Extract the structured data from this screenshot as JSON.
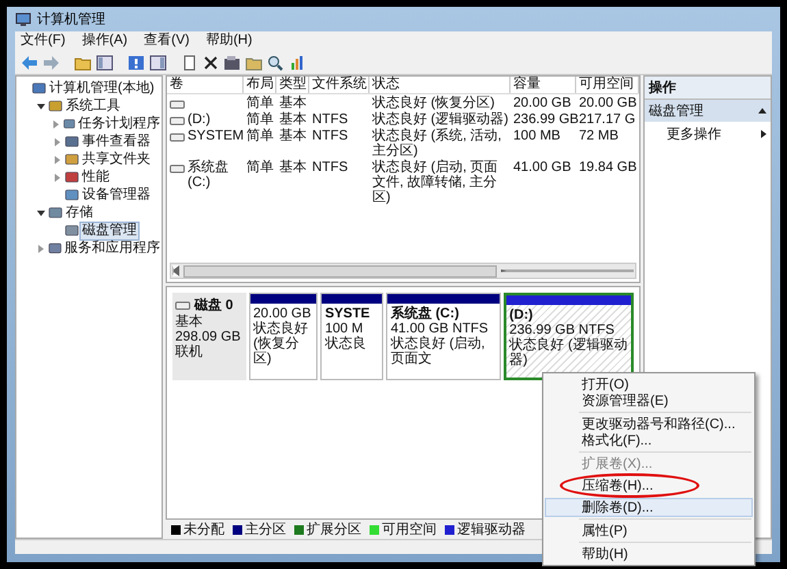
{
  "window": {
    "title": "计算机管理"
  },
  "menu": [
    "文件(F)",
    "操作(A)",
    "查看(V)",
    "帮助(H)"
  ],
  "tree": [
    {
      "label": "计算机管理(本地)",
      "kind": "computer",
      "selected": false,
      "children": [
        {
          "label": "系统工具",
          "kind": "tools",
          "expanded": true,
          "selected": false,
          "children": [
            {
              "label": "任务计划程序",
              "kind": "clock",
              "expanded": false,
              "selected": false
            },
            {
              "label": "事件查看器",
              "kind": "log",
              "expanded": false,
              "selected": false
            },
            {
              "label": "共享文件夹",
              "kind": "share",
              "expanded": false,
              "selected": false
            },
            {
              "label": "性能",
              "kind": "gauge",
              "expanded": false,
              "selected": false
            },
            {
              "label": "设备管理器",
              "kind": "device",
              "selected": false
            }
          ]
        },
        {
          "label": "存储",
          "kind": "storage",
          "expanded": true,
          "selected": false,
          "children": [
            {
              "label": "磁盘管理",
              "kind": "disk",
              "selected": true
            }
          ]
        },
        {
          "label": "服务和应用程序",
          "kind": "services",
          "expanded": false,
          "selected": false
        }
      ]
    }
  ],
  "volumes": {
    "columns": [
      "卷",
      "布局",
      "类型",
      "文件系统",
      "状态",
      "容量",
      "可用空间"
    ],
    "rows": [
      {
        "layout": "简单",
        "type": "基本",
        "status": "状态良好 (恢复分区)",
        "capacity": "20.00 GB",
        "free": "20.00 GB"
      },
      {
        "volume": "(D:)",
        "layout": "简单",
        "type": "基本",
        "fs": "NTFS",
        "status": "状态良好 (逻辑驱动器)",
        "capacity": "236.99 GB",
        "free": "217.17 G"
      },
      {
        "volume": "SYSTEM",
        "layout": "简单",
        "type": "基本",
        "fs": "NTFS",
        "status": "状态良好 (系统, 活动, 主分区)",
        "capacity": "100 MB",
        "free": "72 MB"
      },
      {
        "volume": "系统盘 (C:)",
        "layout": "简单",
        "type": "基本",
        "fs": "NTFS",
        "status": "状态良好 (启动, 页面文件, 故障转储, 主分区)",
        "capacity": "41.00 GB",
        "free": "19.84 GB"
      }
    ]
  },
  "disk": {
    "name": "磁盘 0",
    "type": "基本",
    "size": "298.09 GB",
    "state": "联机",
    "partitions": [
      {
        "kind": "primary",
        "size": "20.00 GB",
        "status": "状态良好 (恢复分区)",
        "selected": false
      },
      {
        "kind": "primary",
        "name": "SYSTE",
        "size": "100 M",
        "status": "状态良",
        "selected": false
      },
      {
        "kind": "primary",
        "name": "系统盘 (C:)",
        "size": "41.00 GB NTFS",
        "status": "状态良好 (启动, 页面文",
        "selected": false
      },
      {
        "kind": "logical",
        "name": "(D:)",
        "size": "236.99 GB NTFS",
        "status": "状态良好 (逻辑驱动器)",
        "selected": true
      }
    ]
  },
  "legend": [
    {
      "label": "未分配",
      "color": "#000000"
    },
    {
      "label": "主分区",
      "color": "#000080"
    },
    {
      "label": "扩展分区",
      "color": "#1e7a1e"
    },
    {
      "label": "可用空间",
      "color": "#33dd33"
    },
    {
      "label": "逻辑驱动器",
      "color": "#2020d0"
    }
  ],
  "actions": {
    "title": "操作",
    "section": "磁盘管理",
    "items": [
      "更多操作"
    ]
  },
  "context_menu": [
    {
      "kind": "item",
      "label": "打开(O)",
      "disabled": false,
      "highlighted": false,
      "circled": false
    },
    {
      "kind": "item",
      "label": "资源管理器(E)",
      "disabled": false,
      "highlighted": false,
      "circled": false
    },
    {
      "kind": "separator"
    },
    {
      "kind": "item",
      "label": "更改驱动器号和路径(C)...",
      "disabled": false,
      "highlighted": false,
      "circled": false
    },
    {
      "kind": "item",
      "label": "格式化(F)...",
      "disabled": false,
      "highlighted": false,
      "circled": false
    },
    {
      "kind": "separator"
    },
    {
      "kind": "item",
      "label": "扩展卷(X)...",
      "disabled": true,
      "highlighted": false,
      "circled": false
    },
    {
      "kind": "item",
      "label": "压缩卷(H)...",
      "disabled": false,
      "highlighted": false,
      "circled": true
    },
    {
      "kind": "item",
      "label": "删除卷(D)...",
      "disabled": false,
      "highlighted": true,
      "circled": false
    },
    {
      "kind": "separator"
    },
    {
      "kind": "item",
      "label": "属性(P)",
      "disabled": false,
      "highlighted": false,
      "circled": false
    },
    {
      "kind": "separator"
    },
    {
      "kind": "item",
      "label": "帮助(H)",
      "disabled": false,
      "highlighted": false,
      "circled": false
    }
  ]
}
